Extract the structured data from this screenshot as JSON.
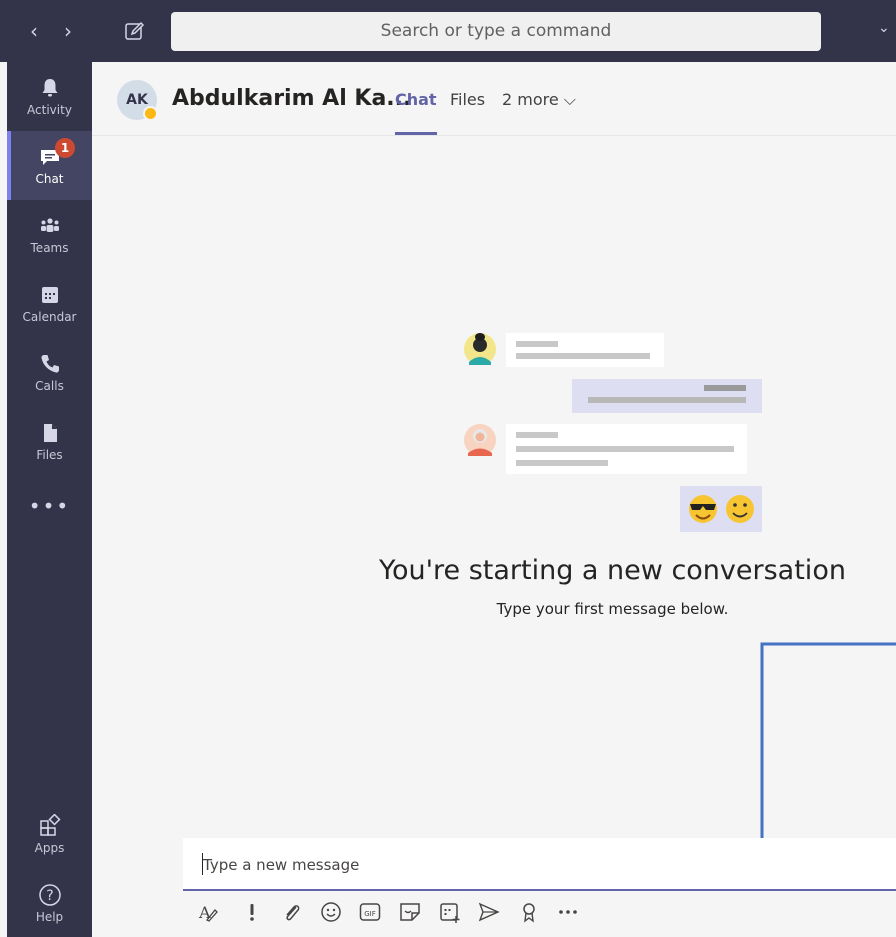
{
  "titlebar": {
    "back_glyph": "‹",
    "forward_glyph": "›",
    "compose_icon": "compose-icon",
    "search_placeholder": "Search or type a command",
    "dropdown_glyph": "⌄"
  },
  "rail": {
    "items": [
      {
        "label": "Activity",
        "icon": "bell-icon"
      },
      {
        "label": "Chat",
        "icon": "chat-icon",
        "badge": "1",
        "active": true
      },
      {
        "label": "Teams",
        "icon": "teams-icon"
      },
      {
        "label": "Calendar",
        "icon": "calendar-icon"
      },
      {
        "label": "Calls",
        "icon": "phone-icon"
      },
      {
        "label": "Files",
        "icon": "file-icon"
      }
    ],
    "more": "•••",
    "bottom": [
      {
        "label": "Apps",
        "icon": "apps-icon"
      },
      {
        "label": "Help",
        "icon": "help-icon"
      }
    ]
  },
  "header": {
    "avatar_initials": "AK",
    "contact_name": "Abdulkarim Al Ka...",
    "tabs": [
      "Chat",
      "Files",
      "2 more ⌵"
    ]
  },
  "empty_state": {
    "title": "You're starting a new conversation",
    "subtitle": "Type your first message below."
  },
  "compose": {
    "placeholder": "Type a new message"
  },
  "toolbar": {
    "icons": [
      "format-icon",
      "important-icon",
      "attach-icon",
      "emoji-icon",
      "gif-icon",
      "sticker-icon",
      "schedule-meeting-icon",
      "send-icon",
      "praise-icon",
      "more-options-icon"
    ]
  },
  "colors": {
    "rail_bg": "#33344a",
    "accent": "#6264a7",
    "badge": "#cc4a31",
    "annotation": "#4472c4"
  }
}
